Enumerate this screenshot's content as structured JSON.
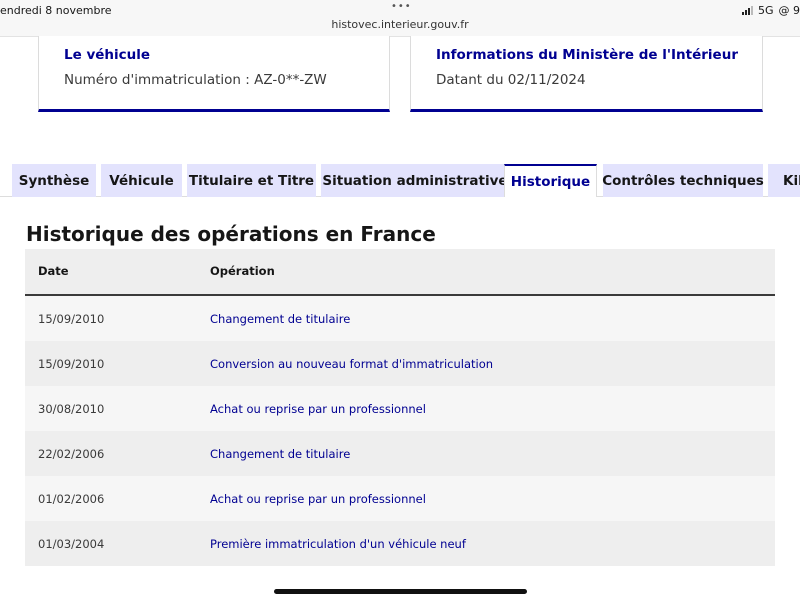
{
  "status_bar": {
    "date": "endredi 8 novembre",
    "url": "histovec.interieur.gouv.fr",
    "network": "5G",
    "extra": "@ 9",
    "dots": "•••"
  },
  "cards": [
    {
      "title": "Le véhicule",
      "text": "Numéro d'immatriculation : AZ-0**-ZW"
    },
    {
      "title": "Informations du Ministère de l'Intérieur",
      "text": "Datant du 02/11/2024"
    }
  ],
  "tabs": [
    {
      "label": "Synthèse",
      "active": false
    },
    {
      "label": "Véhicule",
      "active": false
    },
    {
      "label": "Titulaire et Titre",
      "active": false
    },
    {
      "label": "Situation administrative",
      "active": false
    },
    {
      "label": "Historique",
      "active": true
    },
    {
      "label": "Contrôles techniques",
      "active": false
    },
    {
      "label": "Kilo",
      "active": false
    }
  ],
  "section": {
    "title": "Historique des opérations en France",
    "columns": [
      "Date",
      "Opération"
    ],
    "rows": [
      {
        "date": "15/09/2010",
        "operation": "Changement de titulaire"
      },
      {
        "date": "15/09/2010",
        "operation": "Conversion au nouveau format d'immatriculation"
      },
      {
        "date": "30/08/2010",
        "operation": "Achat ou reprise par un professionnel"
      },
      {
        "date": "22/02/2006",
        "operation": "Changement de titulaire"
      },
      {
        "date": "01/02/2006",
        "operation": "Achat ou reprise par un professionnel"
      },
      {
        "date": "01/03/2004",
        "operation": "Première immatriculation d'un véhicule neuf"
      }
    ]
  },
  "colors": {
    "accent": "#000091",
    "tab_background": "#e3e3fd",
    "row_odd": "#f6f6f6",
    "row_even": "#eeeeee"
  }
}
